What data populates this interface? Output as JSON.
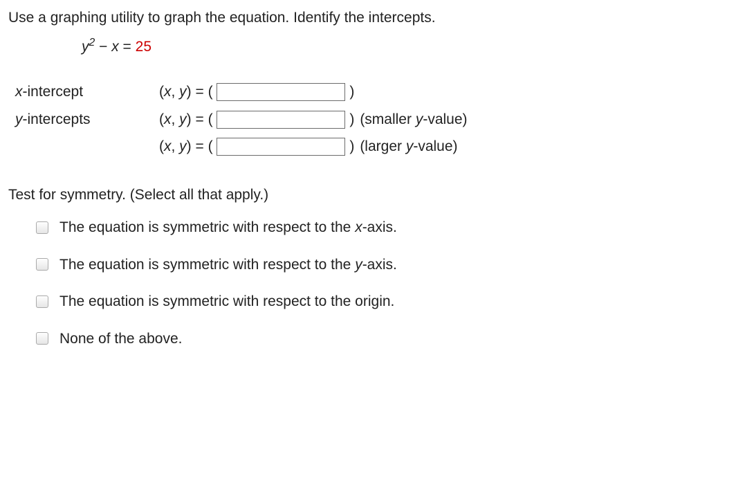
{
  "question": {
    "prompt": "Use a graphing utility to graph the equation. Identify the intercepts.",
    "equation_lhs_html": "y² − x = ",
    "equation_rhs": "25"
  },
  "intercepts": {
    "x_label": "x-intercept",
    "y_label": "y-intercepts",
    "xy_prefix": "(x, y) = ( ",
    "xy_suffix": " )",
    "hint_smaller": " (smaller y-value)",
    "hint_larger": " (larger y-value)"
  },
  "symmetry": {
    "prompt": "Test for symmetry. (Select all that apply.)",
    "options": [
      "The equation is symmetric with respect to the x-axis.",
      "The equation is symmetric with respect to the y-axis.",
      "The equation is symmetric with respect to the origin.",
      "None of the above."
    ]
  }
}
